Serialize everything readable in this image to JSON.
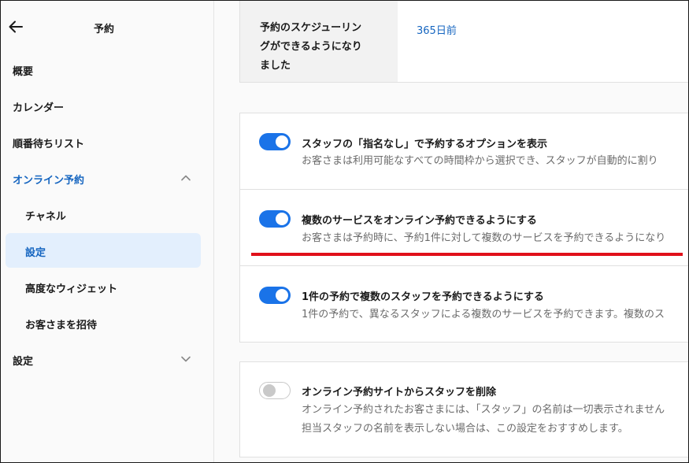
{
  "sidebar": {
    "title": "予約",
    "items": [
      {
        "label": "概要"
      },
      {
        "label": "カレンダー"
      },
      {
        "label": "順番待ちリスト"
      },
      {
        "label": "オンライン予約"
      },
      {
        "label": "チャネル"
      },
      {
        "label": "設定"
      },
      {
        "label": "高度なウィジェット"
      },
      {
        "label": "お客さまを招待"
      },
      {
        "label": "設定"
      }
    ]
  },
  "schedule": {
    "label": "予約のスケジューリングができるようになりました",
    "label_lines": [
      "予約のスケジューリン",
      "グができるようになり",
      "ました"
    ],
    "value": "365日前"
  },
  "settings": [
    {
      "title": "スタッフの「指名なし」で予約するオプションを表示",
      "description": "お客さまは利用可能なすべての時間枠から選択でき、スタッフが自動的に割り",
      "enabled": true
    },
    {
      "title": "複数のサービスをオンライン予約できるようにする",
      "description": "お客さまは予約時に、予約1件に対して複数のサービスを予約できるようになり",
      "enabled": true
    },
    {
      "title": "1件の予約で複数のスタッフを予約できるようにする",
      "description": "1件の予約で、異なるスタッフによる複数のサービスを予約できます。複数のス",
      "enabled": true
    },
    {
      "title": "オンライン予約サイトからスタッフを削除",
      "description_lines": [
        "オンライン予約されたお客さまには、「スタッフ」の名前は一切表示されません",
        "担当スタッフの名前を表示しない場合は、この設定をおすすめします。"
      ],
      "enabled": false
    }
  ],
  "colors": {
    "accent": "#1a73e8",
    "link": "#1565c0",
    "selected_bg": "#e3effd",
    "annotation_line": "#e0101a"
  },
  "icons": {
    "back": "back-arrow-icon",
    "expanded": "chevron-up-icon",
    "collapsed": "chevron-down-icon"
  }
}
